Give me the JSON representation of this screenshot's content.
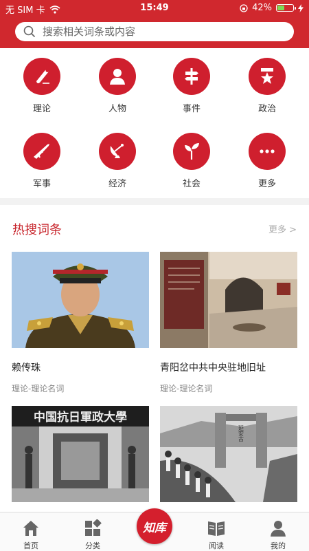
{
  "status": {
    "carrier": "无 SIM 卡",
    "time": "15:49",
    "battery": "42%",
    "battery_level": 0.42
  },
  "search": {
    "placeholder": "搜索相关词条或内容"
  },
  "categories": [
    {
      "label": "理论",
      "icon": "scroll-icon"
    },
    {
      "label": "人物",
      "icon": "person-icon"
    },
    {
      "label": "事件",
      "icon": "signpost-icon"
    },
    {
      "label": "政治",
      "icon": "medal-icon"
    },
    {
      "label": "军事",
      "icon": "rifle-icon"
    },
    {
      "label": "经济",
      "icon": "satellite-dish-icon"
    },
    {
      "label": "社会",
      "icon": "sprout-icon"
    },
    {
      "label": "更多",
      "icon": "more-dots-icon"
    }
  ],
  "hot": {
    "title": "热搜词条",
    "more": "更多 >",
    "cards": [
      {
        "name": "赖传珠",
        "sub": "理论-理论名词"
      },
      {
        "name": "青阳岔中共中央驻地旧址",
        "sub": "理论-理论名词"
      },
      {
        "name": "",
        "sub": ""
      },
      {
        "name": "",
        "sub": ""
      }
    ]
  },
  "photo_text": {
    "plaque": "中国抗日軍政大學",
    "gate": "延安古"
  },
  "tabs": [
    {
      "label": "首页"
    },
    {
      "label": "分类"
    },
    {
      "label": "知库"
    },
    {
      "label": "阅读"
    },
    {
      "label": "我的"
    }
  ],
  "colors": {
    "brand": "#d0282e",
    "icon_circle": "#cf1f2e"
  }
}
